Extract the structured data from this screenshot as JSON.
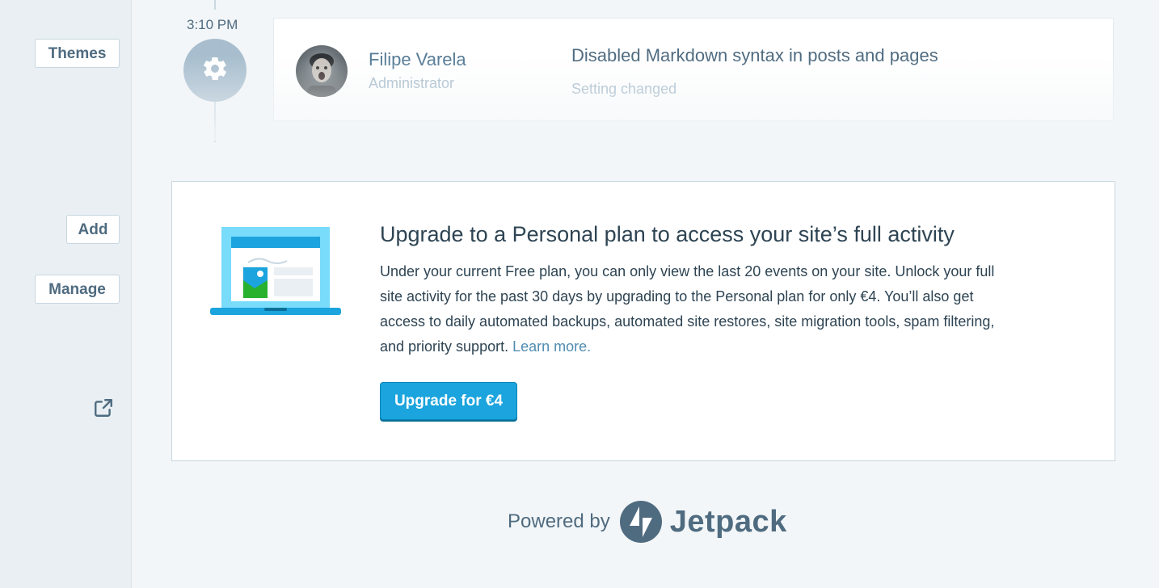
{
  "sidebar": {
    "themes_label": "Themes",
    "add_label": "Add",
    "manage_label": "Manage"
  },
  "activity": {
    "time": "3:10 PM",
    "user_name": "Filipe Varela",
    "user_role": "Administrator",
    "title": "Disabled Markdown syntax in posts and pages",
    "subtitle": "Setting changed",
    "icon": "gear-icon"
  },
  "upgrade": {
    "title": "Upgrade to a Personal plan to access your site’s full activity",
    "body": "Under your current Free plan, you can only view the last 20 events on your site. Unlock your full site activity for the past 30 days by upgrading to the Personal plan for only €4. You’ll also get access to daily automated backups, automated site restores, site migration tools, spam filtering, and priority support.",
    "link_label": "Learn more.",
    "button_label": "Upgrade for €4"
  },
  "footer": {
    "powered_by": "Powered by",
    "brand": "Jetpack"
  },
  "colors": {
    "accent": "#1ba4dd",
    "text_dark": "#2e4453",
    "text_muted": "#a2b9c9",
    "link": "#4f8cb1"
  }
}
